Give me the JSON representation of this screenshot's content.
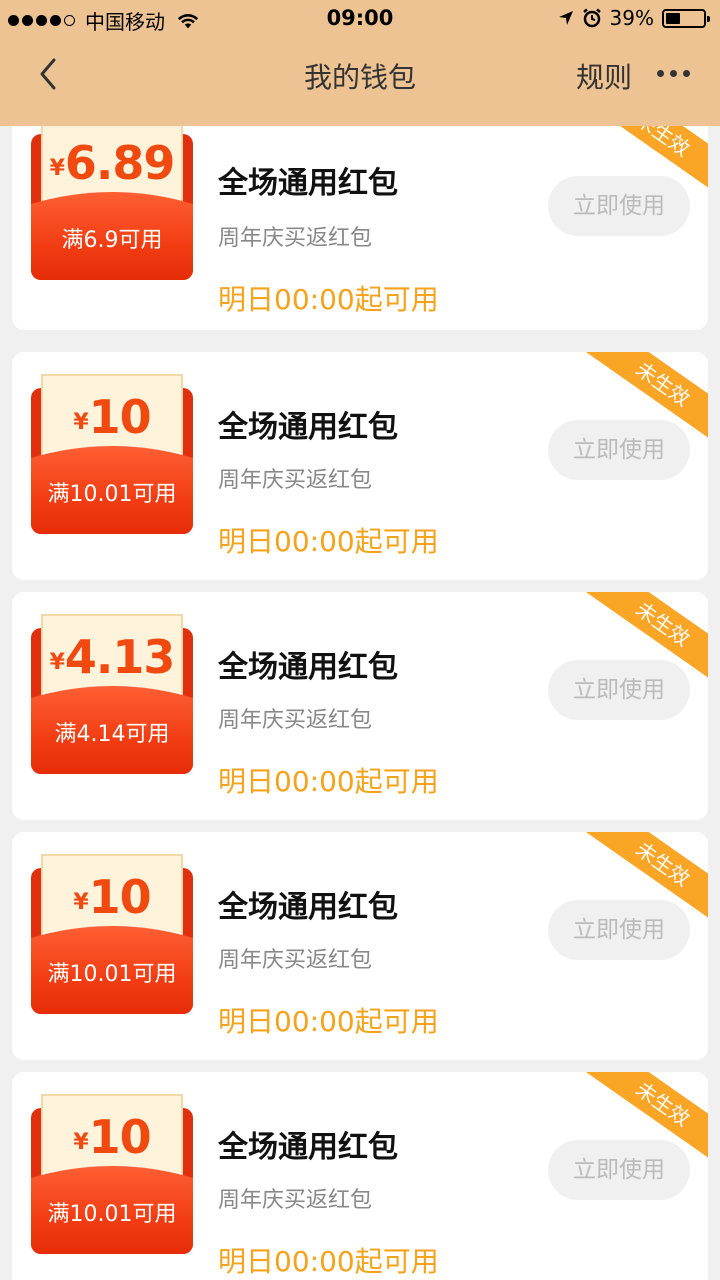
{
  "status_bar": {
    "carrier": "中国移动",
    "time": "09:00",
    "battery": "39%",
    "battery_level": 0.39,
    "signal_bars": 4
  },
  "navbar": {
    "title": "我的钱包",
    "rules_label": "规则"
  },
  "colors": {
    "header_bg": "#eec393",
    "envelope_red": "#e0300f",
    "amount_orange": "#f04a10",
    "time_orange": "#f7a21b",
    "ribbon": "#fba526"
  },
  "coupons": [
    {
      "amount": "6.89",
      "currency": "¥",
      "condition": "满6.9可用",
      "title": "全场通用红包",
      "subtitle": "周年庆买返红包",
      "valid_time": "明日00:00起可用",
      "button": "立即使用",
      "badge": "未生效"
    },
    {
      "amount": "10",
      "currency": "¥",
      "condition": "满10.01可用",
      "title": "全场通用红包",
      "subtitle": "周年庆买返红包",
      "valid_time": "明日00:00起可用",
      "button": "立即使用",
      "badge": "未生效"
    },
    {
      "amount": "4.13",
      "currency": "¥",
      "condition": "满4.14可用",
      "title": "全场通用红包",
      "subtitle": "周年庆买返红包",
      "valid_time": "明日00:00起可用",
      "button": "立即使用",
      "badge": "未生效"
    },
    {
      "amount": "10",
      "currency": "¥",
      "condition": "满10.01可用",
      "title": "全场通用红包",
      "subtitle": "周年庆买返红包",
      "valid_time": "明日00:00起可用",
      "button": "立即使用",
      "badge": "未生效"
    },
    {
      "amount": "10",
      "currency": "¥",
      "condition": "满10.01可用",
      "title": "全场通用红包",
      "subtitle": "周年庆买返红包",
      "valid_time": "明日00:00起可用",
      "button": "立即使用",
      "badge": "未生效"
    }
  ]
}
